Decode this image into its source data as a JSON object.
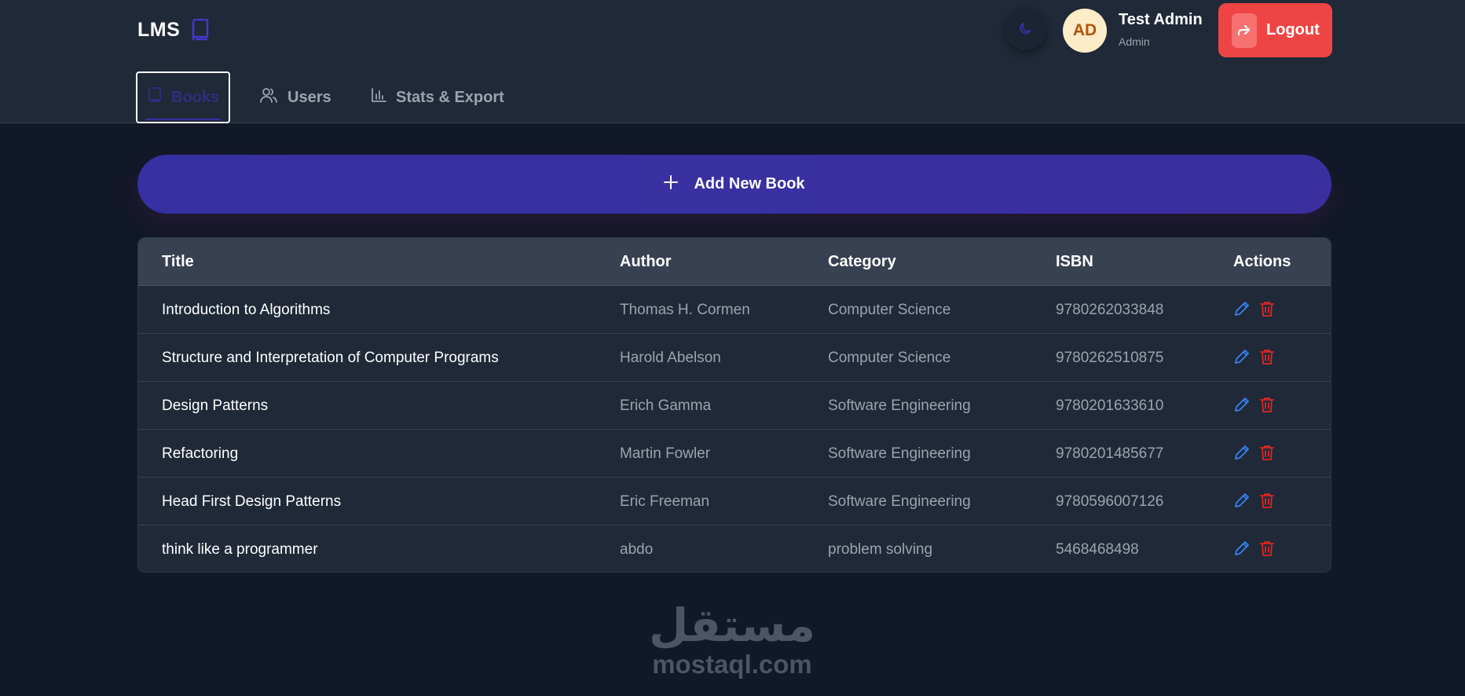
{
  "header": {
    "brand": "LMS",
    "brand_icon": "book-icon",
    "theme_icon": "moon-icon",
    "user": {
      "initials": "AD",
      "name": "Test Admin",
      "role": "Admin"
    },
    "logout_label": "Logout",
    "logout_icon": "logout-arrow-icon"
  },
  "tabs": [
    {
      "label": "Books",
      "icon": "book-icon",
      "active": true
    },
    {
      "label": "Users",
      "icon": "users-icon",
      "active": false
    },
    {
      "label": "Stats & Export",
      "icon": "bar-chart-icon",
      "active": false
    }
  ],
  "add_button": {
    "label": "Add New Book",
    "icon": "plus-icon"
  },
  "table": {
    "columns": [
      "Title",
      "Author",
      "Category",
      "ISBN",
      "Actions"
    ],
    "rows": [
      {
        "title": "Introduction to Algorithms",
        "author": "Thomas H. Cormen",
        "category": "Computer Science",
        "isbn": "9780262033848"
      },
      {
        "title": "Structure and Interpretation of Computer Programs",
        "author": "Harold Abelson",
        "category": "Computer Science",
        "isbn": "9780262510875"
      },
      {
        "title": "Design Patterns",
        "author": "Erich Gamma",
        "category": "Software Engineering",
        "isbn": "9780201633610"
      },
      {
        "title": "Refactoring",
        "author": "Martin Fowler",
        "category": "Software Engineering",
        "isbn": "9780201485677"
      },
      {
        "title": "Head First Design Patterns",
        "author": "Eric Freeman",
        "category": "Software Engineering",
        "isbn": "9780596007126"
      },
      {
        "title": "think like a programmer",
        "author": "abdo",
        "category": "problem solving",
        "isbn": "5468468498"
      }
    ],
    "action_icons": [
      "edit-pencil-icon",
      "delete-trash-icon"
    ]
  },
  "colors": {
    "page_bg": "#111827",
    "header_bg": "#1f2937",
    "accent": "#3730a3",
    "danger": "#ef4444",
    "edit": "#3b82f6"
  },
  "watermark": {
    "arabic": "مستقل",
    "latin": "mostaql.com"
  }
}
